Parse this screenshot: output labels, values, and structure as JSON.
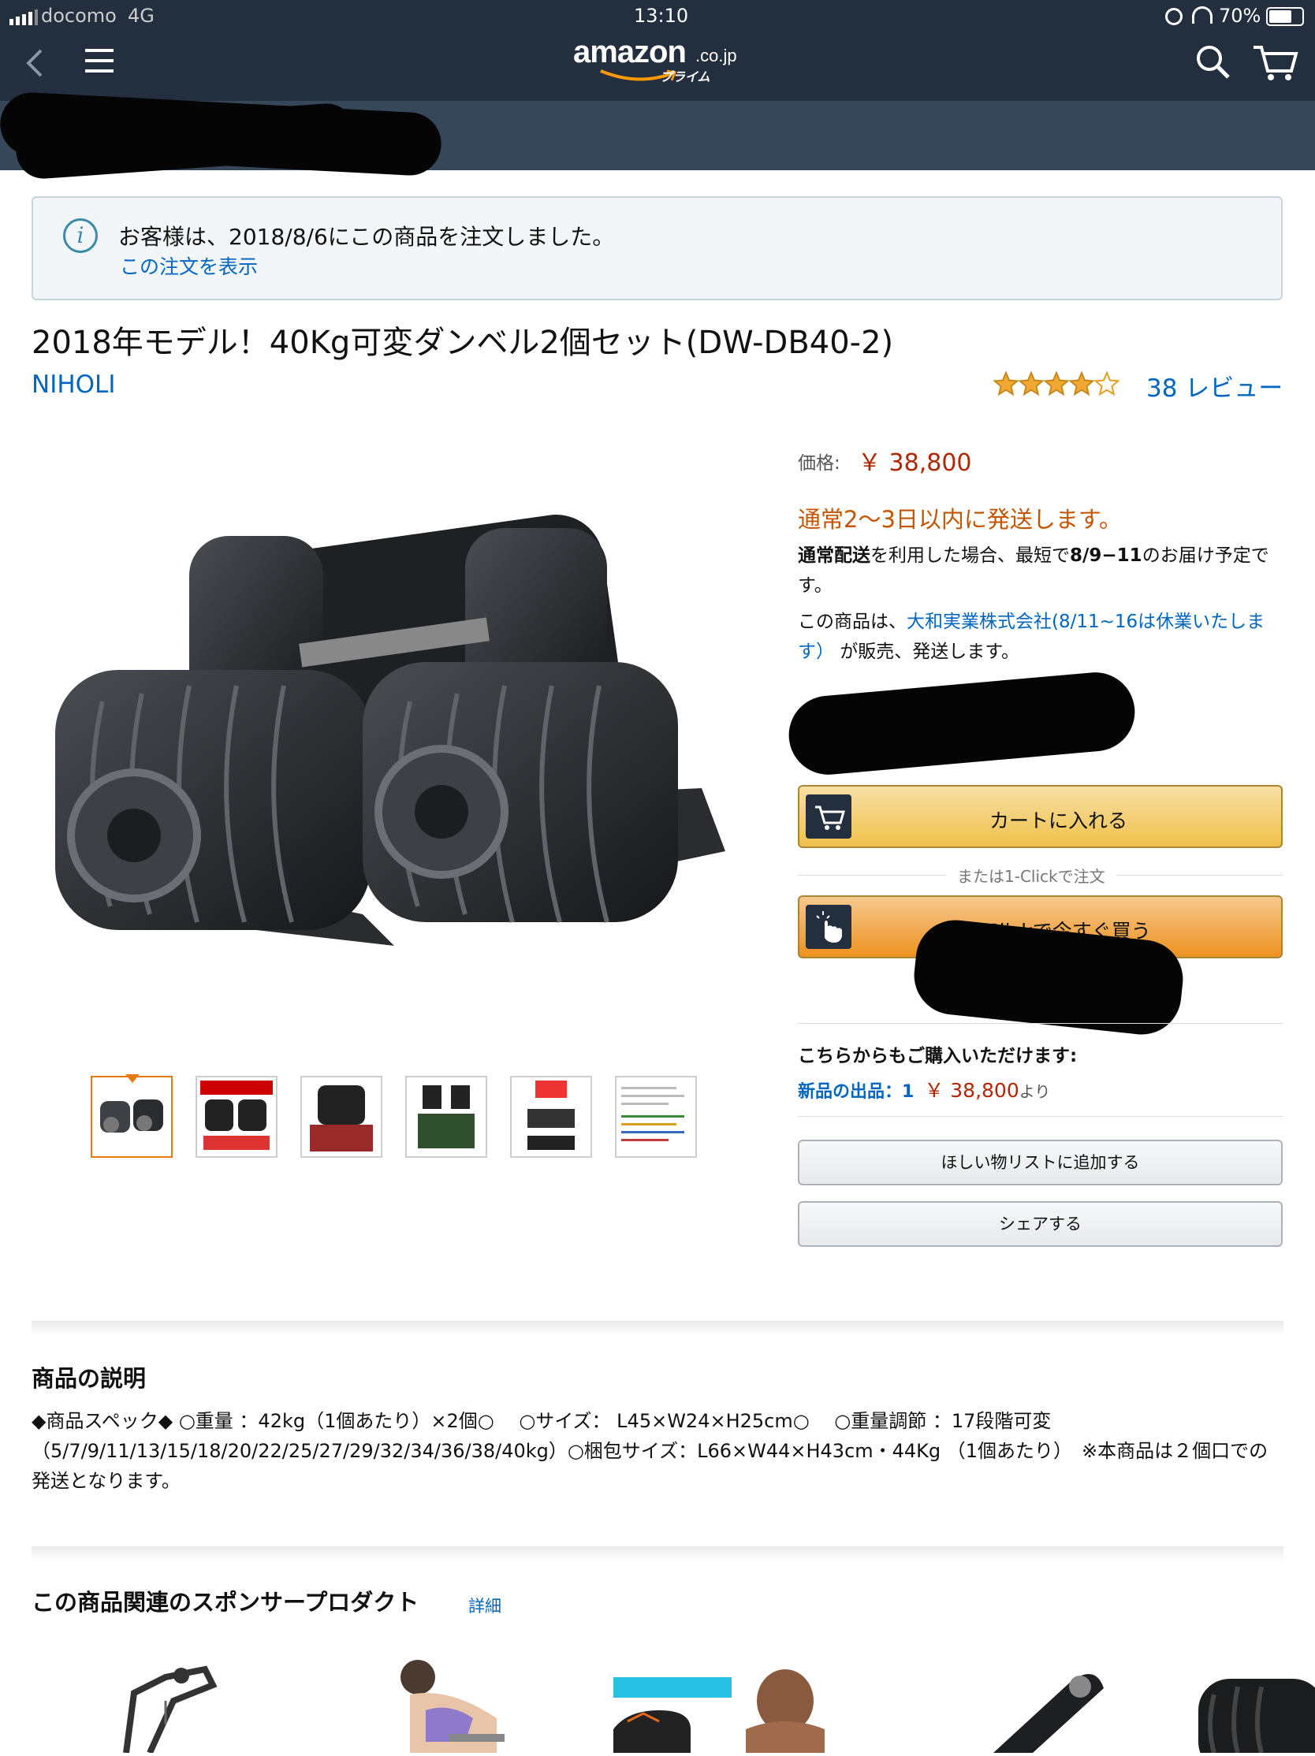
{
  "status_bar": {
    "carrier": "docomo",
    "network": "4G",
    "time": "13:10",
    "battery": "70%"
  },
  "nav": {
    "logo_text": "amazon",
    "logo_suffix": ".co.jp",
    "logo_sub": "プライム"
  },
  "notice": {
    "message": "お客様は、2018/8/6にこの商品を注文しました。",
    "link": "この注文を表示"
  },
  "product": {
    "title": "2018年モデル！40Kg可変ダンベル2個セット(DW-DB40-2)",
    "brand": "NIHOLI",
    "rating": 4,
    "review_count": "38 レビュー",
    "thumbnail_count": 6
  },
  "buybox": {
    "price_label": "価格:",
    "price": "￥ 38,800",
    "ship_status": "通常2〜3日以内に発送します。",
    "delivery_bold1": "通常配送",
    "delivery_text1": "を利用した場合、最短で",
    "delivery_bold2": "8/9−11",
    "delivery_text2": "のお届け予定です。",
    "seller_prefix": "この商品は、",
    "seller_link": "大和実業株式会社(8/11~16は休業いたします）",
    "seller_suffix": " が販売、発送します。",
    "cart_button": "カートに入れる",
    "or_text": "または1-Clickで注文",
    "oneclick_button": "1-Clickで今すぐ買う",
    "other_heading": "こちらからもご購入いただけます:",
    "new_offers_label": "新品の出品：1",
    "new_offers_price": "￥ 38,800",
    "new_offers_suffix": "より",
    "wishlist_button": "ほしい物リストに追加する",
    "share_button": "シェアする"
  },
  "description": {
    "heading": "商品の説明",
    "text": "◆商品スペック◆ ○重量 ：42kg（1個あたり）×2個○　 ○サイズ： L45×W24×H25cm○　 ○重量調節 ：17段階可変（5/7/9/11/13/15/18/20/22/25/27/29/32/34/36/38/40kg）○梱包サイズ：L66×W44×H43cm・44Kg （1個あたり）　※本商品は２個口での発送となります。"
  },
  "sponsored": {
    "heading": "この商品関連のスポンサープロダクト",
    "link": "詳細"
  },
  "colors": {
    "nav_bg": "#232f3e",
    "price_red": "#b12704",
    "ship_orange": "#c45500",
    "link_blue": "#0066c0",
    "cart_yellow": "#f0c14b",
    "oneclick_orange": "#f3a847",
    "star": "#f3a833"
  }
}
